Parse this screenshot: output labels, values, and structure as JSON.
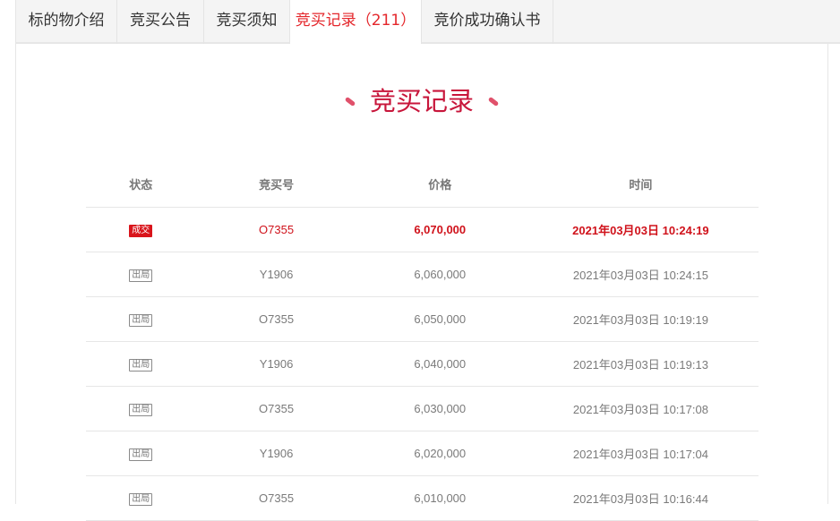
{
  "tabs": [
    {
      "label": "标的物介绍",
      "active": false
    },
    {
      "label": "竞买公告",
      "active": false
    },
    {
      "label": "竞买须知",
      "active": false
    },
    {
      "label": "竞买记录（211）",
      "active": true
    },
    {
      "label": "竞价成功确认书",
      "active": false
    }
  ],
  "section": {
    "title": "竞买记录",
    "accent_color": "#c8163b"
  },
  "table": {
    "headers": {
      "status": "状态",
      "bid_no": "竞买号",
      "price": "价格",
      "time": "时间"
    },
    "rows": [
      {
        "status": "成交",
        "bid_no": "O7355",
        "price": "6,070,000",
        "time": "2021年03月03日 10:24:19"
      },
      {
        "status": "出局",
        "bid_no": "Y1906",
        "price": "6,060,000",
        "time": "2021年03月03日 10:24:15"
      },
      {
        "status": "出局",
        "bid_no": "O7355",
        "price": "6,050,000",
        "time": "2021年03月03日 10:19:19"
      },
      {
        "status": "出局",
        "bid_no": "Y1906",
        "price": "6,040,000",
        "time": "2021年03月03日 10:19:13"
      },
      {
        "status": "出局",
        "bid_no": "O7355",
        "price": "6,030,000",
        "time": "2021年03月03日 10:17:08"
      },
      {
        "status": "出局",
        "bid_no": "Y1906",
        "price": "6,020,000",
        "time": "2021年03月03日 10:17:04"
      },
      {
        "status": "出局",
        "bid_no": "O7355",
        "price": "6,010,000",
        "time": "2021年03月03日 10:16:44"
      }
    ]
  },
  "colors": {
    "active_tab_text": "#e4262b",
    "winner_text": "#d0121b",
    "deal_badge_bg": "#d9141b"
  }
}
